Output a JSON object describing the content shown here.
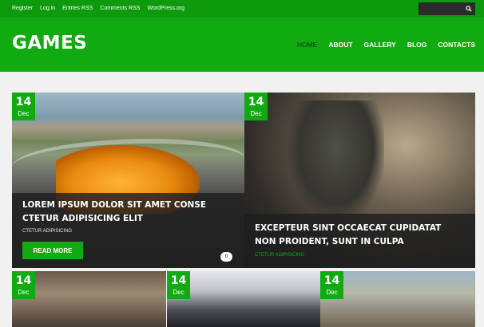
{
  "topbar": {
    "links": [
      "Register",
      "Log in",
      "Entries RSS",
      "Comments RSS",
      "WordPress.org"
    ],
    "search_icon": "search-icon"
  },
  "header": {
    "logo": "GAMES",
    "nav": [
      "HOME",
      "ABOUT",
      "GALLERY",
      "BLOG",
      "CONTACTS"
    ],
    "active_nav": "HOME"
  },
  "posts": [
    {
      "day": "14",
      "month": "Dec",
      "title": "LOREM IPSUM DOLOR SIT AMET CONSE CTETUR ADIPISICING ELIT",
      "category": "CTETUR ADIPISICING",
      "read_more": "READ MORE",
      "comments": "0"
    },
    {
      "day": "14",
      "month": "Dec",
      "title": "EXCEPTEUR SINT OCCAECAT CUPIDATAT NON PROIDENT, SUNT IN CULPA",
      "category": "CTETUR ADIPISICING"
    },
    {
      "day": "14",
      "month": "Dec"
    },
    {
      "day": "14",
      "month": "Dec"
    },
    {
      "day": "14",
      "month": "Dec"
    }
  ],
  "colors": {
    "brand_green": "#11ab11",
    "topbar_green": "#0d9a0d",
    "category_green_tile2": "#11ab11"
  }
}
